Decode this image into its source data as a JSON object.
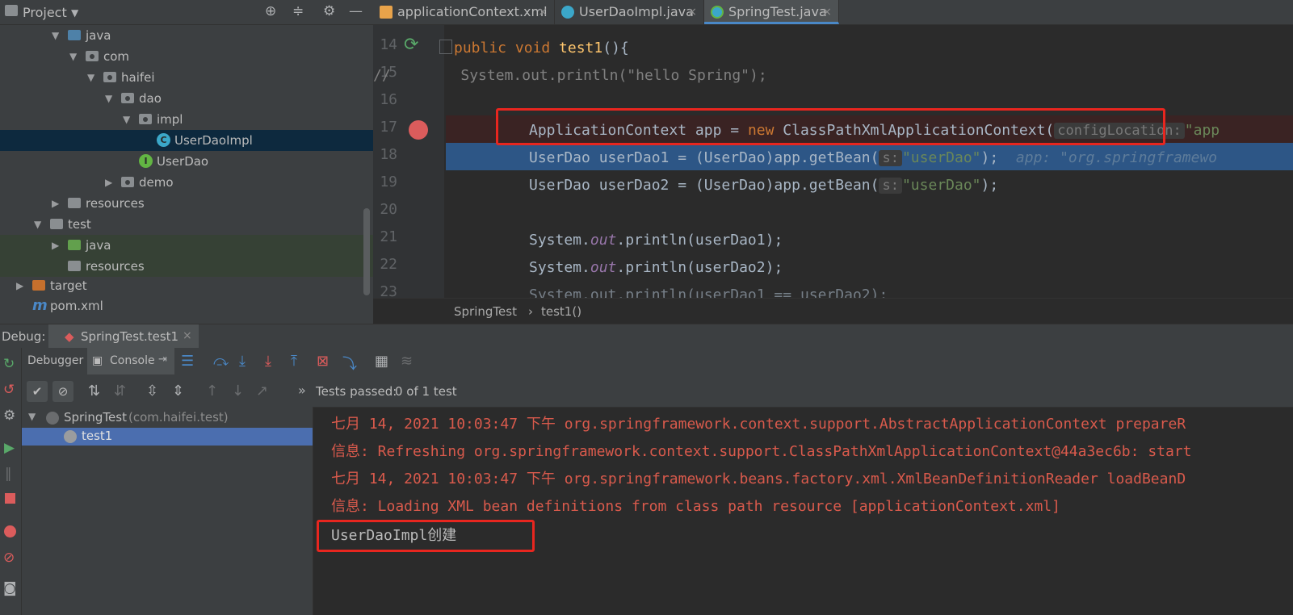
{
  "project": {
    "title": "Project",
    "tree": [
      {
        "label": "java",
        "icon": "folder-blue-icon",
        "arrow": "▼"
      },
      {
        "label": "com",
        "icon": "package-icon",
        "arrow": "▼"
      },
      {
        "label": "haifei",
        "icon": "package-icon",
        "arrow": "▼"
      },
      {
        "label": "dao",
        "icon": "package-icon",
        "arrow": "▼"
      },
      {
        "label": "impl",
        "icon": "package-icon",
        "arrow": "▼"
      },
      {
        "label": "UserDaoImpl",
        "icon": "class-icon"
      },
      {
        "label": "UserDao",
        "icon": "interface-icon"
      },
      {
        "label": "demo",
        "icon": "package-icon",
        "arrow": "▶"
      },
      {
        "label": "resources",
        "icon": "resources-folder-icon",
        "arrow": "▶"
      },
      {
        "label": "test",
        "icon": "folder-gray-icon",
        "arrow": "▼"
      },
      {
        "label": "java",
        "icon": "folder-green-icon",
        "arrow": "▶"
      },
      {
        "label": "resources",
        "icon": "resources-folder-icon"
      },
      {
        "label": "target",
        "icon": "folder-orange-icon",
        "arrow": "▶"
      },
      {
        "label": "pom.xml",
        "icon": "maven-icon"
      }
    ]
  },
  "tabs": [
    {
      "label": "applicationContext.xml",
      "icon": "xml-file-icon",
      "close": "×"
    },
    {
      "label": "UserDaoImpl.java",
      "icon": "class-icon",
      "close": "×"
    },
    {
      "label": "SpringTest.java",
      "icon": "test-class-icon",
      "close": "×"
    }
  ],
  "editor": {
    "lines": [
      {
        "n": "14"
      },
      {
        "n": "15"
      },
      {
        "n": "16"
      },
      {
        "n": "17"
      },
      {
        "n": "18"
      },
      {
        "n": "19"
      },
      {
        "n": "20"
      },
      {
        "n": "21"
      },
      {
        "n": "22"
      },
      {
        "n": "23"
      }
    ],
    "code": {
      "l14a": "public void ",
      "l14b": "test1",
      "l14c": "(){",
      "l15a": "//",
      "l15b": "        System.out.println(\"hello Spring\");",
      "l17a": "ApplicationContext app = ",
      "l17b": "new ",
      "l17c": "ClassPathXmlApplicationContext(",
      "l17hint": "configLocation:",
      "l17str": "\"app",
      "l18a": "UserDao userDao1 = (UserDao)app.getBean(",
      "l18hint": "s:",
      "l18str": "\"userDao\"",
      "l18b": ");",
      "l18inline": "app: \"org.springframewo",
      "l19a": "UserDao userDao2 = (UserDao)app.getBean(",
      "l19hint": "s:",
      "l19str": "\"userDao\"",
      "l19b": ");",
      "l21a": "System.",
      "l21b": "out",
      "l21c": ".println(userDao1);",
      "l22a": "System.",
      "l22b": "out",
      "l22c": ".println(userDao2);",
      "l23": "System.out.println(userDao1 == userDao2);"
    }
  },
  "breadcrumb": [
    "SpringTest",
    "›",
    "test1()"
  ],
  "debug": {
    "label": "Debug:",
    "session": "SpringTest.test1",
    "close": "×",
    "tab_debugger": "Debugger",
    "tab_console": "Console",
    "tests_passed_prefix": "Tests passed:",
    "tests_passed_value": "0 of 1 test",
    "chevron": "»",
    "suite_name": "SpringTest",
    "suite_pkg": "(com.haifei.test)",
    "test_name": "test1"
  },
  "console": [
    {
      "text": "七月 14, 2021 10:03:47 下午 org.springframework.context.support.AbstractApplicationContext prepareR",
      "type": "err"
    },
    {
      "text": "信息: Refreshing org.springframework.context.support.ClassPathXmlApplicationContext@44a3ec6b: start",
      "type": "err"
    },
    {
      "text": "七月 14, 2021 10:03:47 下午 org.springframework.beans.factory.xml.XmlBeanDefinitionReader loadBeanD",
      "type": "err"
    },
    {
      "text": "信息: Loading XML bean definitions from class path resource [applicationContext.xml]",
      "type": "err"
    },
    {
      "text": "UserDaoImpl创建",
      "type": "out"
    }
  ],
  "colors": {
    "accent": "#4a88c7",
    "highlight_box": "#e8261f",
    "console_error": "#d95a4c"
  }
}
